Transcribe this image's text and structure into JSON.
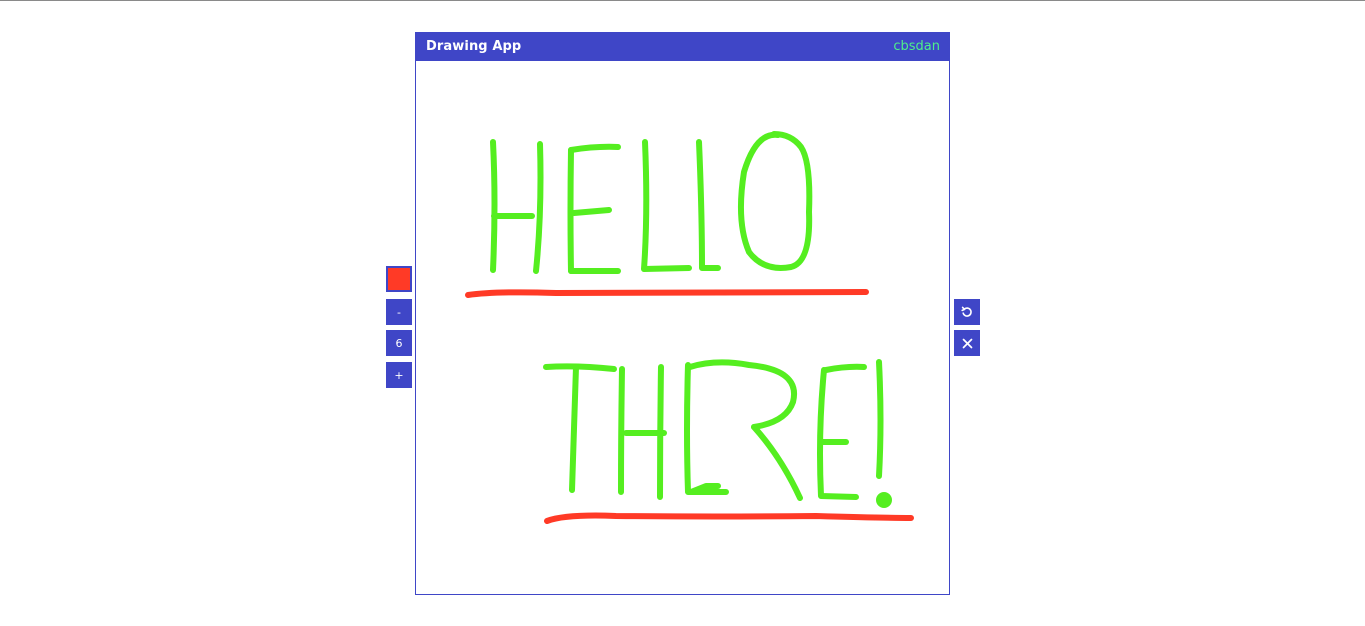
{
  "header": {
    "title": "Drawing App",
    "user": "cbsdan"
  },
  "toolbar": {
    "current_color": "#ff3a26",
    "decrease_label": "-",
    "brush_size": "6",
    "increase_label": "+"
  },
  "actions": {
    "undo_icon": "undo-icon",
    "clear_icon": "close-icon"
  },
  "colors": {
    "accent": "#3f46c7",
    "green_stroke": "#55ee20",
    "red_stroke": "#ff3a26",
    "user_color": "#4ef08a"
  }
}
